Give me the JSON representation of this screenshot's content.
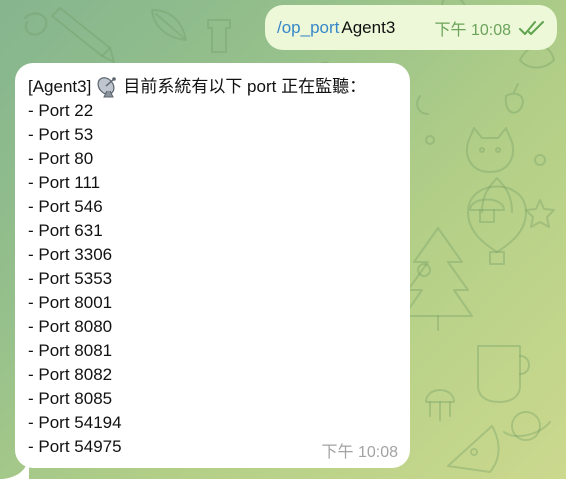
{
  "outgoing_message": {
    "command": "/op_port",
    "argument": "Agent3",
    "time": "下午 10:08",
    "status_icon": "double-check-icon"
  },
  "incoming_message": {
    "prefix": "[Agent3]",
    "icon": "satellite-antenna-icon",
    "header": "目前系統有以下 port 正在監聽：",
    "ports": [
      "- Port 22",
      "- Port 53",
      "- Port 80",
      "- Port 111",
      "- Port 546",
      "- Port 631",
      "- Port 3306",
      "- Port 5353",
      "- Port 8001",
      "- Port 8080",
      "- Port 8081",
      "- Port 8082",
      "- Port 8085",
      "- Port 54194",
      "- Port 54975"
    ],
    "time": "下午 10:08"
  },
  "colors": {
    "outgoing_bubble": "#ecf8d8",
    "incoming_bubble": "#ffffff",
    "command_link": "#3787c8",
    "outgoing_meta": "#6ba35a",
    "incoming_meta": "#a3a3a3"
  }
}
